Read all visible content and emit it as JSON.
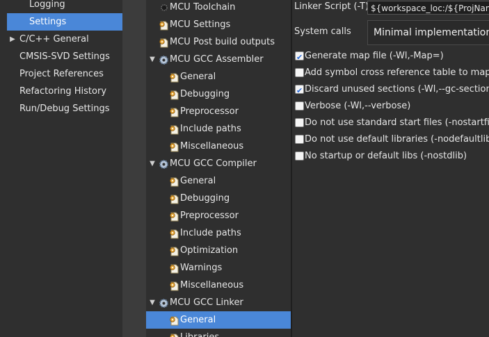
{
  "categories": [
    {
      "label": "Logging",
      "indent": true,
      "expandable": false,
      "selected": false
    },
    {
      "label": "Settings",
      "indent": true,
      "expandable": false,
      "selected": true
    },
    {
      "label": "C/C++ General",
      "indent": false,
      "expandable": true,
      "selected": false
    },
    {
      "label": "CMSIS-SVD Settings",
      "indent": false,
      "expandable": false,
      "selected": false
    },
    {
      "label": "Project References",
      "indent": false,
      "expandable": false,
      "selected": false
    },
    {
      "label": "Refactoring History",
      "indent": false,
      "expandable": false,
      "selected": false
    },
    {
      "label": "Run/Debug Settings",
      "indent": false,
      "expandable": false,
      "selected": false
    }
  ],
  "tree": [
    {
      "label": "MCU Toolchain",
      "level": 0,
      "kind": "toolchain",
      "expanded": false,
      "selected": false
    },
    {
      "label": "MCU Settings",
      "level": 0,
      "kind": "option",
      "expanded": false,
      "selected": false
    },
    {
      "label": "MCU Post build outputs",
      "level": 0,
      "kind": "option",
      "expanded": false,
      "selected": false
    },
    {
      "label": "MCU GCC Assembler",
      "level": 0,
      "kind": "tool",
      "expanded": true,
      "selected": false
    },
    {
      "label": "General",
      "level": 1,
      "kind": "option",
      "expanded": false,
      "selected": false
    },
    {
      "label": "Debugging",
      "level": 1,
      "kind": "option",
      "expanded": false,
      "selected": false
    },
    {
      "label": "Preprocessor",
      "level": 1,
      "kind": "option",
      "expanded": false,
      "selected": false
    },
    {
      "label": "Include paths",
      "level": 1,
      "kind": "option",
      "expanded": false,
      "selected": false
    },
    {
      "label": "Miscellaneous",
      "level": 1,
      "kind": "option",
      "expanded": false,
      "selected": false
    },
    {
      "label": "MCU GCC Compiler",
      "level": 0,
      "kind": "tool",
      "expanded": true,
      "selected": false
    },
    {
      "label": "General",
      "level": 1,
      "kind": "option",
      "expanded": false,
      "selected": false
    },
    {
      "label": "Debugging",
      "level": 1,
      "kind": "option",
      "expanded": false,
      "selected": false
    },
    {
      "label": "Preprocessor",
      "level": 1,
      "kind": "option",
      "expanded": false,
      "selected": false
    },
    {
      "label": "Include paths",
      "level": 1,
      "kind": "option",
      "expanded": false,
      "selected": false
    },
    {
      "label": "Optimization",
      "level": 1,
      "kind": "option",
      "expanded": false,
      "selected": false
    },
    {
      "label": "Warnings",
      "level": 1,
      "kind": "option",
      "expanded": false,
      "selected": false
    },
    {
      "label": "Miscellaneous",
      "level": 1,
      "kind": "option",
      "expanded": false,
      "selected": false
    },
    {
      "label": "MCU GCC Linker",
      "level": 0,
      "kind": "tool",
      "expanded": true,
      "selected": false
    },
    {
      "label": "General",
      "level": 1,
      "kind": "option",
      "expanded": false,
      "selected": true
    },
    {
      "label": "Libraries",
      "level": 1,
      "kind": "option",
      "expanded": false,
      "selected": false
    }
  ],
  "options": {
    "linker_script_label": "Linker Script (-T)",
    "linker_script_value": "${workspace_loc:/${ProjName}",
    "system_calls_label": "System calls",
    "system_calls_value": "Minimal implementation",
    "checkboxes": [
      {
        "label": "Generate map file (-Wl,-Map=)",
        "checked": true
      },
      {
        "label": "Add symbol cross reference table to map file",
        "checked": false
      },
      {
        "label": "Discard unused sections (-Wl,--gc-sections)",
        "checked": true
      },
      {
        "label": "Verbose (-Wl,--verbose)",
        "checked": false
      },
      {
        "label": "Do not use standard start files (-nostartfiles)",
        "checked": false
      },
      {
        "label": "Do not use default libraries (-nodefaultlibs)",
        "checked": false
      },
      {
        "label": "No startup or default libs (-nostdlib)",
        "checked": false
      }
    ]
  },
  "colors": {
    "selection": "#4a87d8",
    "panel": "#2f2f2f",
    "checkmark": "#2a6bd8",
    "option_icon": "#e9a93a",
    "tool_icon": "#b8c7d9"
  }
}
